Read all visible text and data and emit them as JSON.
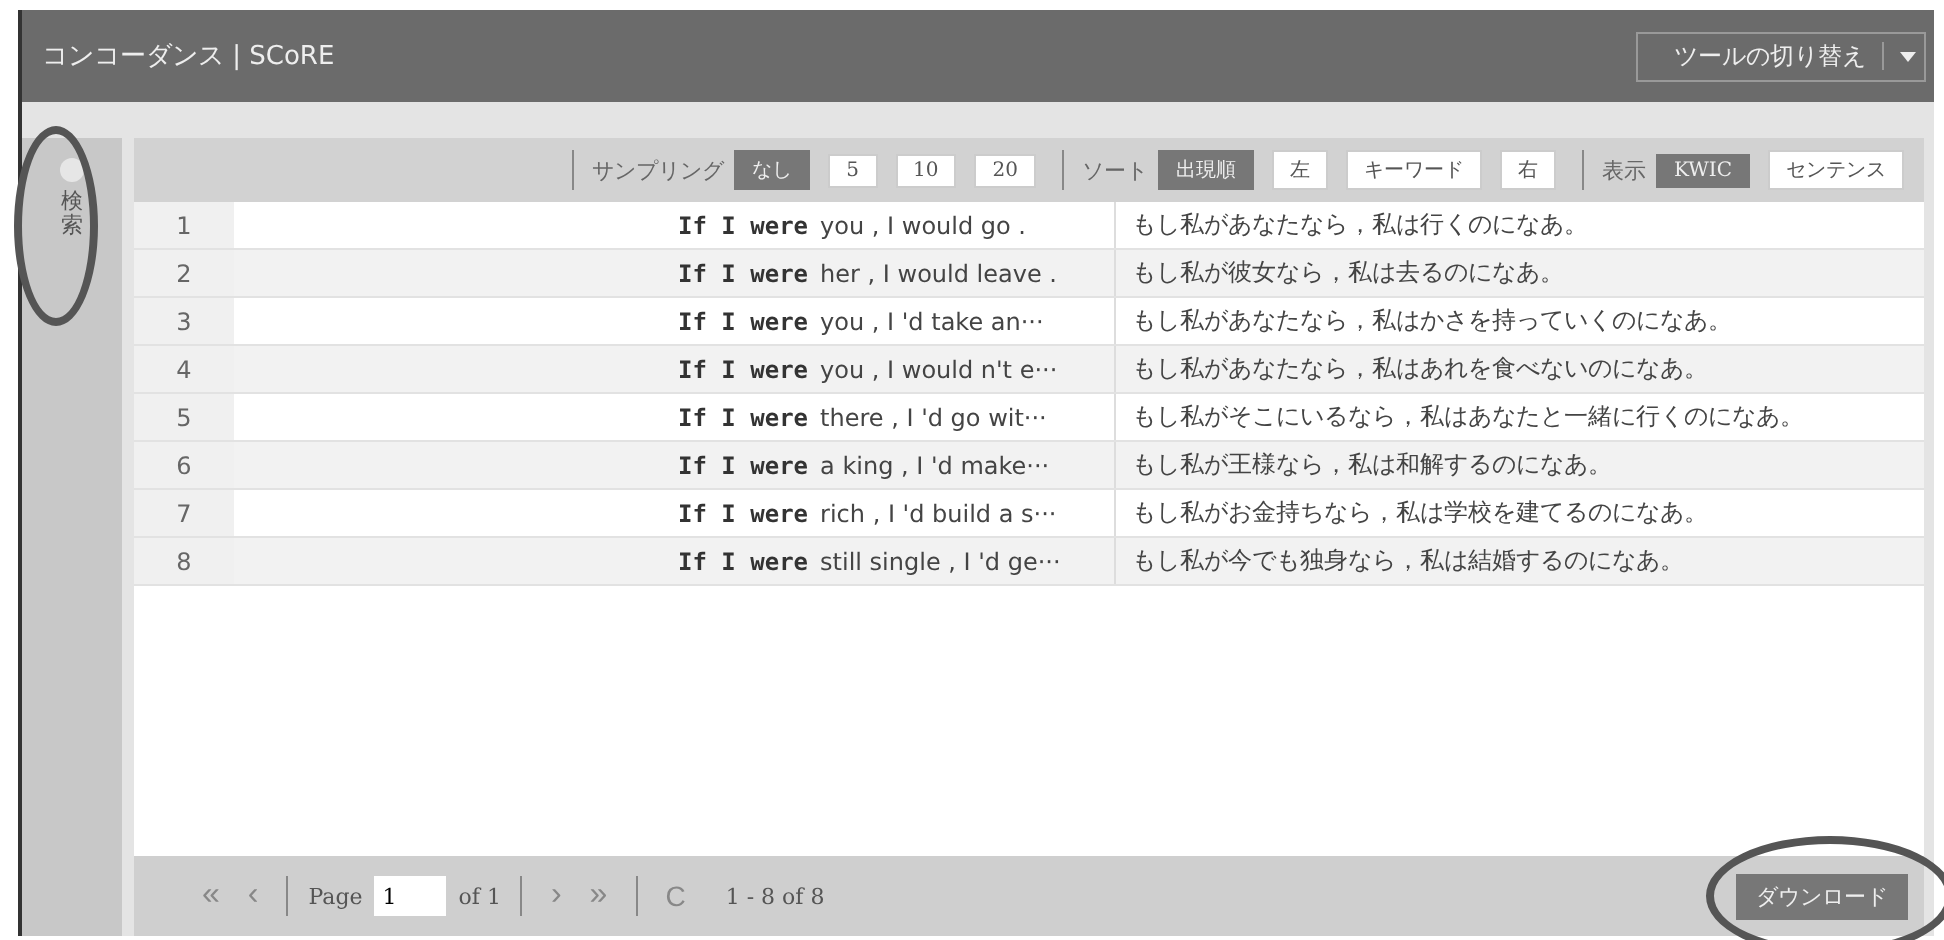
{
  "window": {
    "title": "コンコーダンス | SCoRE",
    "tool_switch": "ツールの切り替え"
  },
  "sidebar": {
    "label": "検索"
  },
  "toolbar": {
    "groups": [
      {
        "label": "サンプリング",
        "options": [
          {
            "label": "なし",
            "selected": true
          },
          {
            "label": "5",
            "selected": false
          },
          {
            "label": "10",
            "selected": false
          },
          {
            "label": "20",
            "selected": false
          }
        ]
      },
      {
        "label": "ソート",
        "options": [
          {
            "label": "出現順",
            "selected": true
          },
          {
            "label": "左",
            "selected": false
          },
          {
            "label": "キーワード",
            "selected": false
          },
          {
            "label": "右",
            "selected": false
          }
        ]
      },
      {
        "label": "表示",
        "options": [
          {
            "label": "KWIC",
            "selected": true
          },
          {
            "label": "センテンス",
            "selected": false
          }
        ]
      }
    ]
  },
  "table": {
    "rows": [
      {
        "number": "1",
        "keyword": "If I were",
        "right": "you , I would go .",
        "translation": "もし私があなたなら，私は行くのになあ。"
      },
      {
        "number": "2",
        "keyword": "If I were",
        "right": "her , I would leave .",
        "translation": "もし私が彼女なら，私は去るのになあ。"
      },
      {
        "number": "3",
        "keyword": "If I were",
        "right": "you , I 'd take an···",
        "translation": "もし私があなたなら，私はかさを持っていくのになあ。"
      },
      {
        "number": "4",
        "keyword": "If I were",
        "right": "you , I would n't e···",
        "translation": "もし私があなたなら，私はあれを食べないのになあ。"
      },
      {
        "number": "5",
        "keyword": "If I were",
        "right": "there , I 'd go wit···",
        "translation": "もし私がそこにいるなら，私はあなたと一緒に行くのになあ。"
      },
      {
        "number": "6",
        "keyword": "If I were",
        "right": "a king , I 'd make···",
        "translation": "もし私が王様なら，私は和解するのになあ。"
      },
      {
        "number": "7",
        "keyword": "If I were",
        "right": "rich , I 'd build a s···",
        "translation": "もし私がお金持ちなら，私は学校を建てるのになあ。"
      },
      {
        "number": "8",
        "keyword": "If I were",
        "right": "still single , I 'd ge···",
        "translation": "もし私が今でも独身なら，私は結婚するのになあ。"
      }
    ]
  },
  "pager": {
    "first": "«",
    "prev": "‹",
    "page_label": "Page",
    "page": "1",
    "of": "of 1",
    "next": "›",
    "last": "»",
    "refresh": "C",
    "summary": "1 - 8 of 8",
    "download": "ダウンロード"
  }
}
